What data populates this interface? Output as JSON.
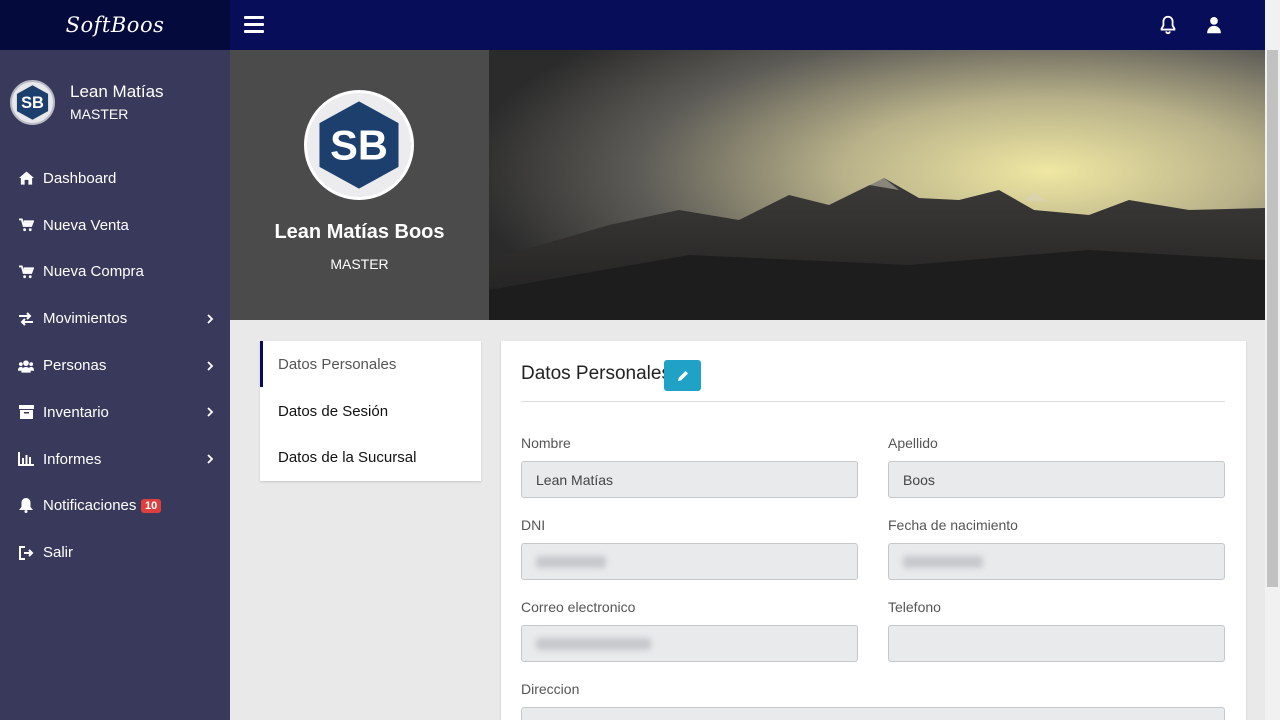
{
  "topbar": {
    "brand": "SoftBoos"
  },
  "sidebar": {
    "user": {
      "name": "Lean Matías",
      "role": "MASTER",
      "avatar_initials": "SB"
    },
    "menu": [
      {
        "label": "Dashboard",
        "icon": "home-icon"
      },
      {
        "label": "Nueva Venta",
        "icon": "cart-icon"
      },
      {
        "label": "Nueva Compra",
        "icon": "cart-icon"
      },
      {
        "label": "Movimientos",
        "icon": "exchange-icon",
        "submenu": true
      },
      {
        "label": "Personas",
        "icon": "users-icon",
        "submenu": true
      },
      {
        "label": "Inventario",
        "icon": "archive-icon",
        "submenu": true
      },
      {
        "label": "Informes",
        "icon": "bar-chart-icon",
        "submenu": true
      },
      {
        "label": "Notificaciones",
        "icon": "bell-icon",
        "badge": "10"
      },
      {
        "label": "Salir",
        "icon": "sign-out-icon"
      }
    ]
  },
  "profile": {
    "name": "Lean Matías Boos",
    "role": "MASTER",
    "avatar_initials": "SB"
  },
  "tabs": [
    {
      "label": "Datos Personales",
      "active": true
    },
    {
      "label": "Datos de Sesión",
      "active": false
    },
    {
      "label": "Datos de la Sucursal",
      "active": false
    }
  ],
  "card": {
    "title": "Datos Personales",
    "fields": {
      "nombre": {
        "label": "Nombre",
        "value": "Lean Matías"
      },
      "apellido": {
        "label": "Apellido",
        "value": "Boos"
      },
      "dni": {
        "label": "DNI",
        "value": ""
      },
      "fecha": {
        "label": "Fecha de nacimiento",
        "value": ""
      },
      "correo": {
        "label": "Correo electronico",
        "value": ""
      },
      "telefono": {
        "label": "Telefono",
        "value": ""
      },
      "direccion": {
        "label": "Direccion",
        "value": ""
      }
    }
  },
  "colors": {
    "topbar": "#070d59",
    "sidebar": "#393a5b",
    "accent": "#1fa2c6",
    "badge": "#dd3f3f"
  }
}
